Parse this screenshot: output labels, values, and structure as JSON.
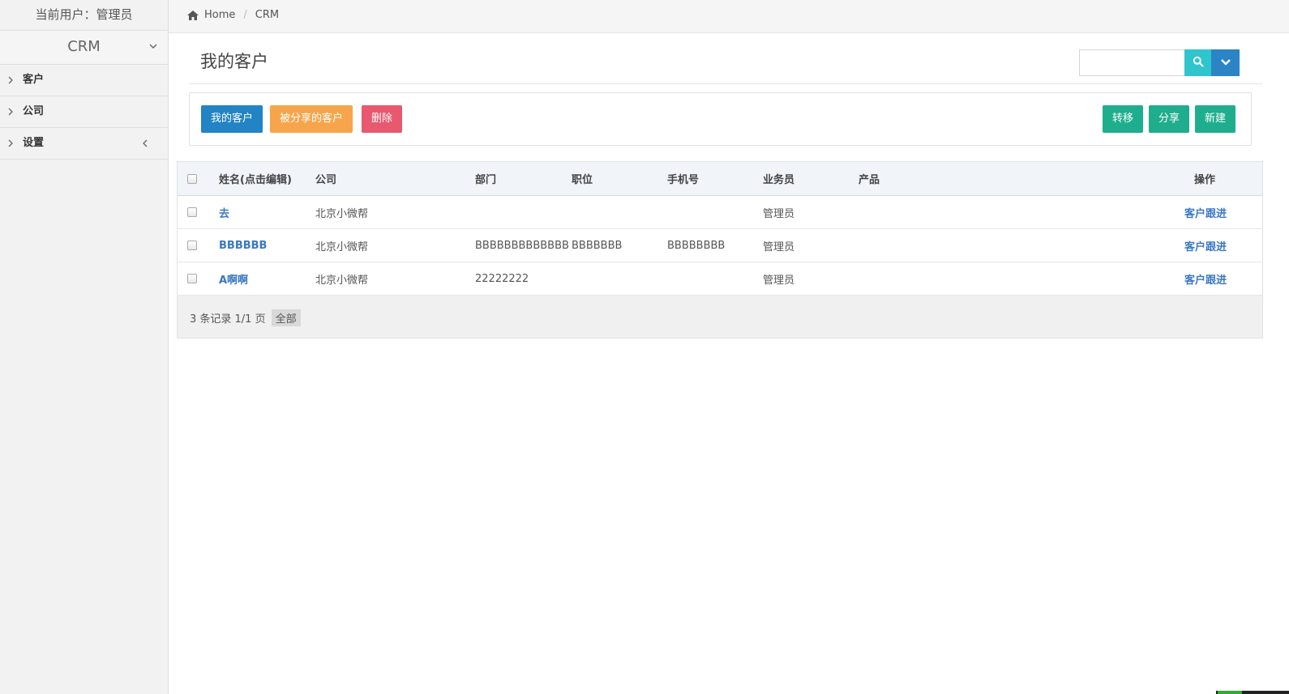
{
  "sidebar": {
    "user_label": "当前用户：管理员",
    "module": "CRM",
    "items": [
      {
        "label": "客户"
      },
      {
        "label": "公司"
      },
      {
        "label": "设置"
      }
    ]
  },
  "breadcrumb": {
    "home": "Home",
    "current": "CRM"
  },
  "page": {
    "title": "我的客户"
  },
  "search": {
    "placeholder": "",
    "value": ""
  },
  "toolbar": {
    "my_customers": "我的客户",
    "shared_customers": "被分享的客户",
    "delete": "删除",
    "transfer": "转移",
    "share": "分享",
    "create": "新建"
  },
  "table": {
    "columns": {
      "name": "姓名(点击编辑)",
      "company": "公司",
      "department": "部门",
      "position": "职位",
      "phone": "手机号",
      "salesperson": "业务员",
      "product": "产品",
      "actions": "操作"
    },
    "rows": [
      {
        "name": "去",
        "company": "北京小微帮",
        "department": "",
        "position": "",
        "phone": "",
        "salesperson": "管理员",
        "product": "",
        "action": "客户跟进"
      },
      {
        "name": "BBBBBB",
        "company": "北京小微帮",
        "department": "BBBBBBBBBBBBB",
        "position": "BBBBBBB",
        "phone": "BBBBBBBB",
        "salesperson": "管理员",
        "product": "",
        "action": "客户跟进"
      },
      {
        "name": "A啊啊",
        "company": "北京小微帮",
        "department": "22222222",
        "position": "",
        "phone": "",
        "salesperson": "管理员",
        "product": "",
        "action": "客户跟进"
      }
    ],
    "footer_info": "3 条记录 1/1 页",
    "footer_all": "全部"
  },
  "colors": {
    "primary": "#2283c5",
    "orange": "#f7a54a",
    "danger": "#e8586e",
    "success": "#1fae8d",
    "search": "#2fc5cd",
    "link": "#3a78c2"
  },
  "icons": {
    "home": "home-icon",
    "search": "search-icon",
    "dropdown": "chevron-down-icon"
  }
}
